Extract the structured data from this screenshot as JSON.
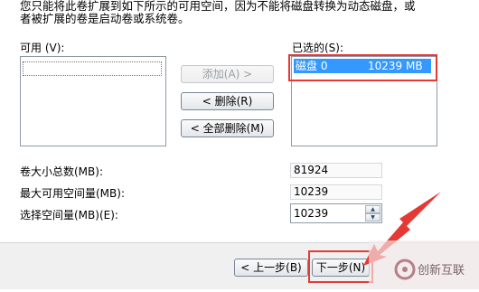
{
  "intro": {
    "line1": "您只能将此卷扩展到如下所示的可用空间，因为不能将磁盘转换为动态磁盘，或",
    "line2": "者被扩展的卷是启动卷或系统卷。"
  },
  "available": {
    "label": "可用 (V):"
  },
  "selected": {
    "label": "已选的(S):",
    "items": [
      {
        "disk": "磁盘 0",
        "size": "10239 MB"
      }
    ]
  },
  "buttons": {
    "add": "添加(A) >",
    "remove": "< 删除(R)",
    "remove_all": "< 全部删除(M)"
  },
  "fields": {
    "total_label": "卷大小总数(MB):",
    "total_value": "81924",
    "max_label": "最大可用空间量(MB):",
    "max_value": "10239",
    "select_label": "选择空间量(MB)(E):",
    "select_value": "10239"
  },
  "footer": {
    "back": "< 上一步(B)",
    "next": "下一步(N)"
  },
  "watermark": {
    "text": "创新互联"
  },
  "colors": {
    "highlight": "#3399ff",
    "annotation_red": "#e53935"
  }
}
